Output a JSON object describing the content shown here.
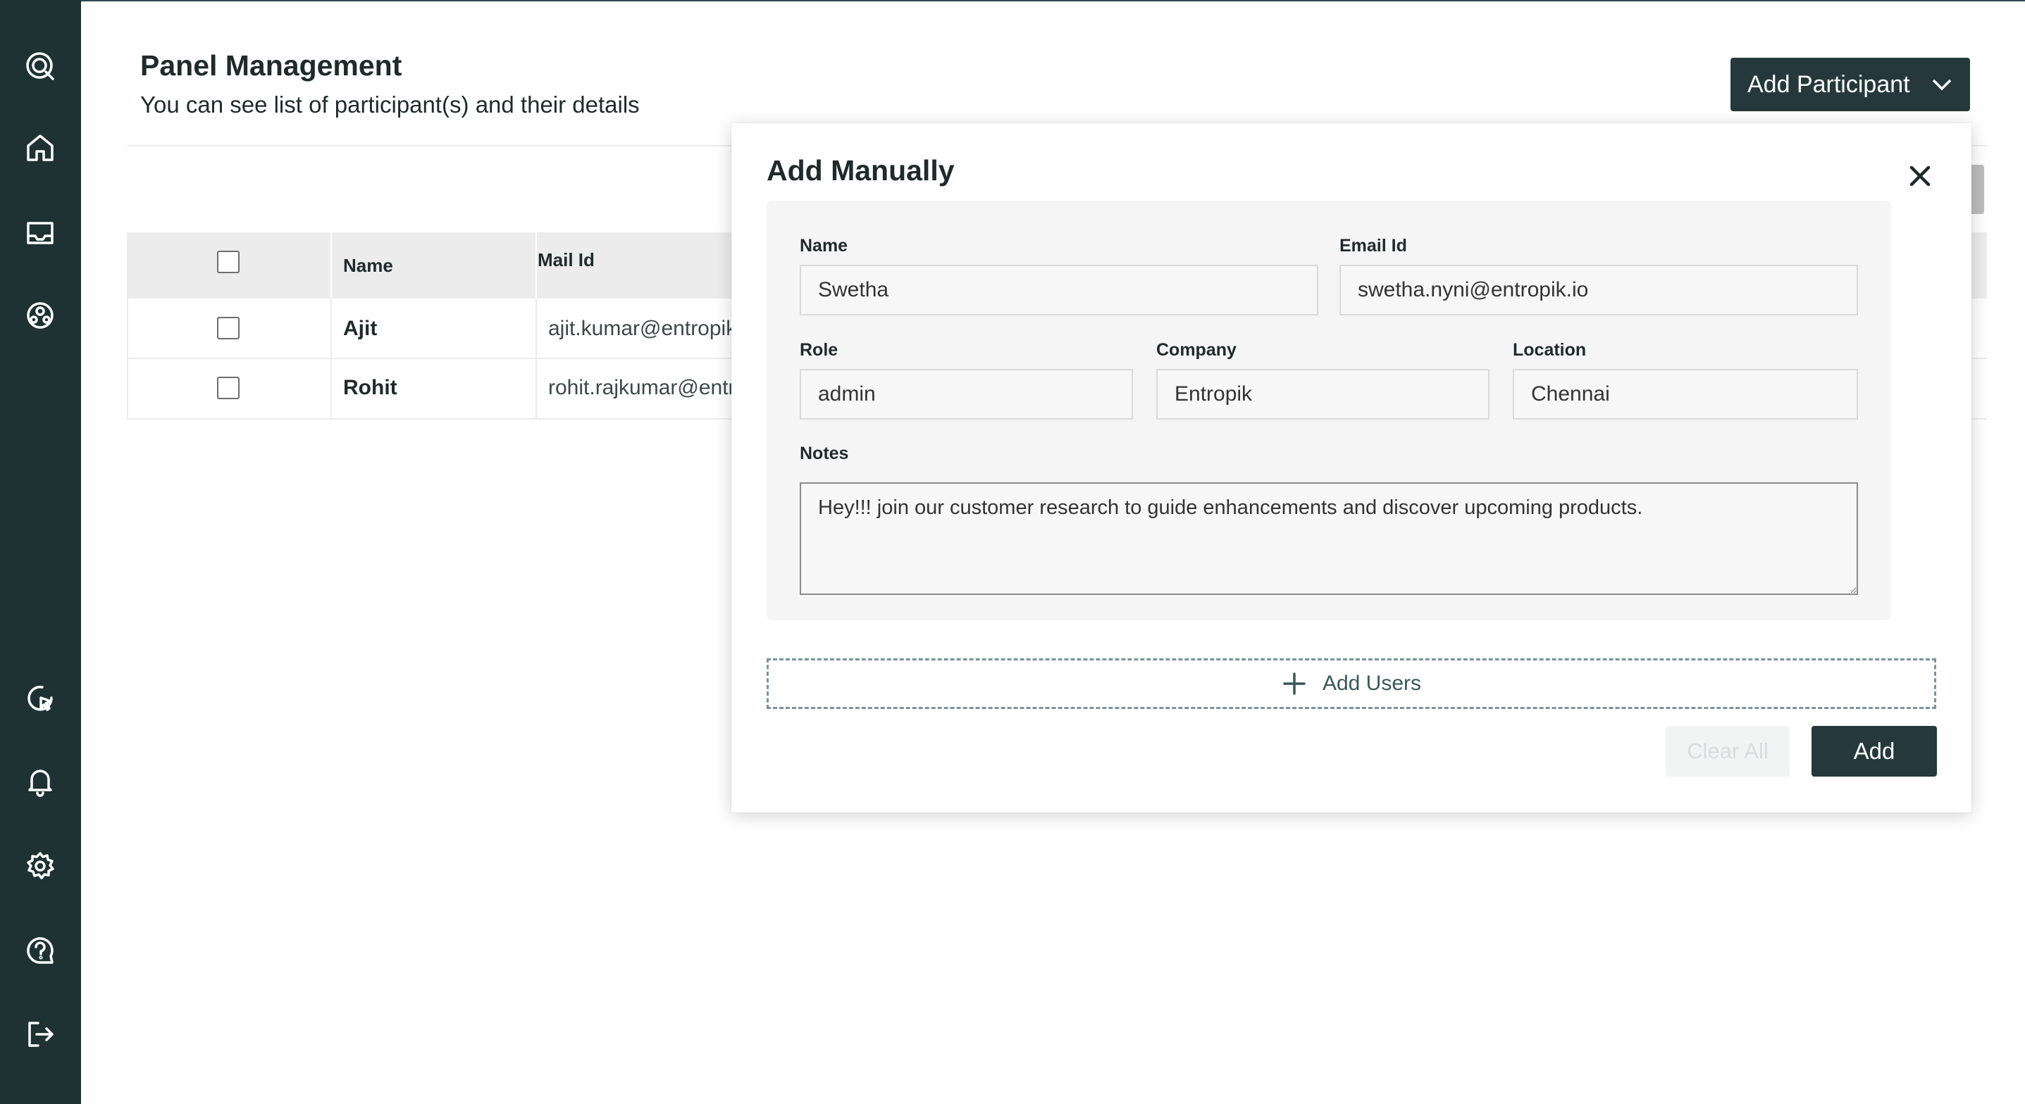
{
  "sidebar": {
    "top_icons": [
      {
        "icon": "search-chat-logo-icon"
      },
      {
        "icon": "home-icon"
      },
      {
        "icon": "inbox-icon"
      },
      {
        "icon": "users-group-icon"
      }
    ],
    "bottom_icons": [
      {
        "icon": "pointer-click-icon"
      },
      {
        "icon": "notification-bell-icon"
      },
      {
        "icon": "settings-gear-icon"
      },
      {
        "icon": "help-question-icon"
      },
      {
        "icon": "logout-icon"
      }
    ]
  },
  "header": {
    "title": "Panel Management",
    "subtitle": "You can see list of participant(s) and their details",
    "add_participant_label": "Add Participant"
  },
  "table": {
    "columns": [
      "Name",
      "Mail Id"
    ],
    "rows": [
      {
        "name": "Ajit",
        "mail": "ajit.kumar@entropik"
      },
      {
        "name": "Rohit",
        "mail": "rohit.rajkumar@entr"
      }
    ]
  },
  "modal": {
    "title": "Add Manually",
    "fields": {
      "name": {
        "label": "Name",
        "value": "Swetha"
      },
      "email": {
        "label": "Email Id",
        "value": "swetha.nyni@entropik.io"
      },
      "role": {
        "label": "Role",
        "value": "admin"
      },
      "company": {
        "label": "Company",
        "value": "Entropik"
      },
      "location": {
        "label": "Location",
        "value": "Chennai"
      },
      "notes": {
        "label": "Notes",
        "value": "Hey!!! join our customer research to guide enhancements and discover upcoming products."
      }
    },
    "add_users_label": "Add Users",
    "clear_all_label": "Clear All",
    "add_label": "Add"
  },
  "colors": {
    "sidebar_bg": "#1e3133",
    "primary_button": "#25393c",
    "dashed_border": "#7a9494"
  }
}
